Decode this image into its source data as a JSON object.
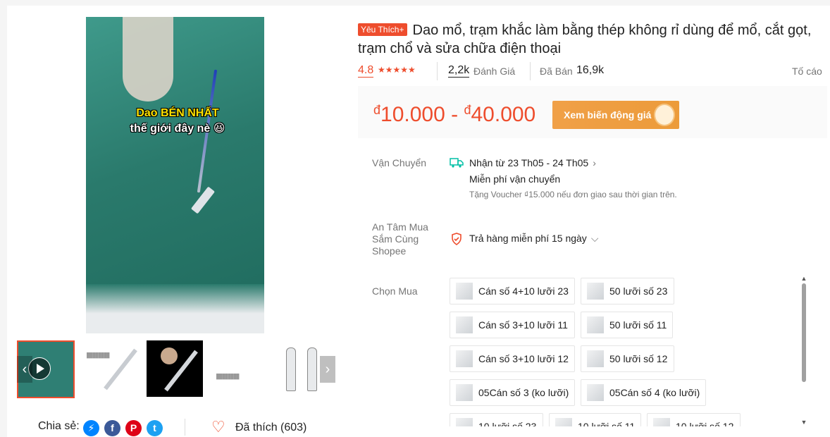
{
  "media": {
    "overlay_line1": "Dao BÉN NHẤT",
    "overlay_line2": "thế giới đây nè 😆"
  },
  "thumbnails": [
    {
      "name": "thumb-video",
      "active": true
    },
    {
      "name": "thumb-blades-handles"
    },
    {
      "name": "thumb-black-scalpel"
    },
    {
      "name": "thumb-blade-guide"
    },
    {
      "name": "thumb-blade-shapes"
    }
  ],
  "share": {
    "label": "Chia sẻ:"
  },
  "like": {
    "label": "Đã thích (603)"
  },
  "product": {
    "badge": "Yêu Thích+",
    "title": "Dao mổ, trạm khắc làm bằng thép không rỉ dùng để mổ, cắt gọt, trạm chổ và sửa chữa điện thoại",
    "rating": "4.8",
    "reviews_count": "2,2k",
    "reviews_label": "Đánh Giá",
    "sold_label": "Đã Bán",
    "sold_count": "16,9k",
    "report_label": "Tố cáo"
  },
  "price": {
    "currency": "đ",
    "min": "10.000",
    "max": "40.000",
    "dash": "-",
    "button_label": "Xem biến động giá"
  },
  "shipping": {
    "label": "Vận Chuyển",
    "eta": "Nhận từ 23 Th05 - 24 Th05",
    "free": "Miễn phí vận chuyển",
    "voucher": "Tặng Voucher ₫15.000 nếu đơn giao sau thời gian trên."
  },
  "guarantee": {
    "label_line1": "An Tâm Mua",
    "label_line2": "Sắm Cùng",
    "label_line3": "Shopee",
    "text": "Trả hàng miễn phí 15 ngày"
  },
  "options": {
    "label": "Chọn Mua",
    "items": [
      "Cán số 4+10 lưỡi 23",
      "50 lưỡi số 23",
      "Cán số 3+10 lưỡi 11",
      "50 lưỡi số 11",
      "Cán số 3+10 lưỡi 12",
      "50 lưỡi số 12",
      "05Cán số 3 (ko lưỡi)",
      "05Cán số 4 (ko lưỡi)",
      "10 lưỡi số 23",
      "10 lưỡi số 11",
      "10 lưỡi số 12"
    ]
  },
  "colors": {
    "accent": "#ee4d2d",
    "price_button": "#f0a047"
  }
}
